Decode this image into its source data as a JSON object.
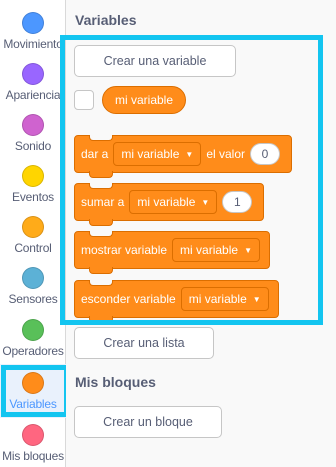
{
  "categories": [
    {
      "label": "Movimiento",
      "color": "#4c97ff",
      "icon": "category-dot-icon"
    },
    {
      "label": "Apariencia",
      "color": "#9966ff",
      "icon": "category-dot-icon"
    },
    {
      "label": "Sonido",
      "color": "#cf63cf",
      "icon": "category-dot-icon"
    },
    {
      "label": "Eventos",
      "color": "#ffd500",
      "icon": "category-dot-icon"
    },
    {
      "label": "Control",
      "color": "#ffab19",
      "icon": "category-dot-icon"
    },
    {
      "label": "Sensores",
      "color": "#5cb1d6",
      "icon": "category-dot-icon"
    },
    {
      "label": "Operadores",
      "color": "#59c059",
      "icon": "category-dot-icon"
    },
    {
      "label": "Variables",
      "color": "#ff8c1a",
      "icon": "category-dot-icon",
      "selected": true
    },
    {
      "label": "Mis bloques",
      "color": "#ff6680",
      "icon": "category-dot-icon"
    }
  ],
  "palette": {
    "variables_heading": "Variables",
    "create_variable_button": "Crear una variable",
    "variable_reporter": "mi variable",
    "blocks": {
      "set": {
        "prefix": "dar a",
        "dropdown": "mi variable",
        "middle": "el valor",
        "value": "0"
      },
      "change": {
        "prefix": "sumar a",
        "dropdown": "mi variable",
        "value": "1"
      },
      "show": {
        "prefix": "mostrar variable",
        "dropdown": "mi variable"
      },
      "hide": {
        "prefix": "esconder variable",
        "dropdown": "mi variable"
      }
    },
    "create_list_button": "Crear una lista",
    "my_blocks_heading": "Mis bloques",
    "create_block_button": "Crear un bloque"
  },
  "colors": {
    "accent_highlight": "#13c5f0",
    "variables_block": "#ff8c1a",
    "selected_text": "#4c97ff"
  }
}
